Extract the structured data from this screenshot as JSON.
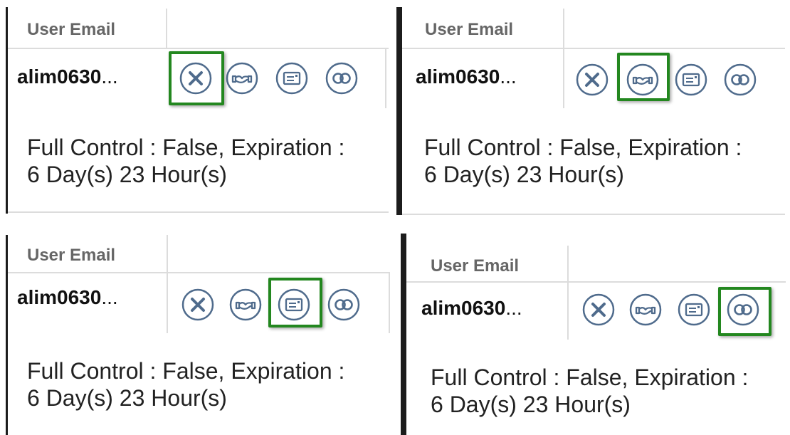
{
  "colors": {
    "highlight": "#23871f",
    "icon_stroke": "#4f6b8c",
    "header_text": "#666666"
  },
  "panels": [
    {
      "header_label": "User Email",
      "email": "alim0630",
      "ellipsis": "...",
      "details_line1": "Full Control : False, Expiration :",
      "details_line2": "6 Day(s) 23 Hour(s)",
      "highlighted_action": "revoke-icon"
    },
    {
      "header_label": "User Email",
      "email": "alim0630",
      "ellipsis": "...",
      "details_line1": "Full Control : False, Expiration :",
      "details_line2": "6 Day(s) 23 Hour(s)",
      "highlighted_action": "handshake-icon"
    },
    {
      "header_label": "User Email",
      "email": "alim0630",
      "ellipsis": "...",
      "details_line1": "Full Control : False, Expiration :",
      "details_line2": "6 Day(s) 23 Hour(s)",
      "highlighted_action": "message-card-icon"
    },
    {
      "header_label": "User Email",
      "email": "alim0630",
      "ellipsis": "...",
      "details_line1": "Full Control : False, Expiration :",
      "details_line2": "6 Day(s) 23 Hour(s)",
      "highlighted_action": "link-icon"
    }
  ]
}
